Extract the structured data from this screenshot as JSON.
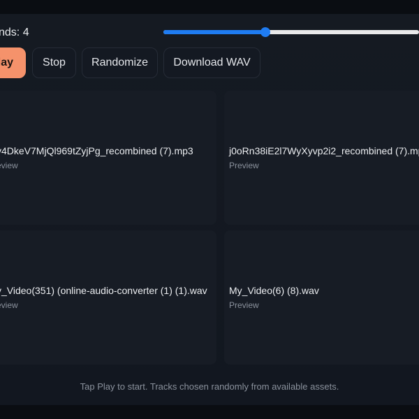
{
  "controls": {
    "rounds_label": "nds: 4",
    "rounds_value": 4,
    "slider_fill_fraction": 0.4
  },
  "toolbar": {
    "play_label": "lay",
    "stop_label": "Stop",
    "randomize_label": "Randomize",
    "download_label": "Download WAV"
  },
  "tracks": [
    {
      "name": "v4DkeV7MjQl969tZyjPg_recombined (7).mp3",
      "status": "eview"
    },
    {
      "name": "j0oRn38iE2l7WyXyvp2i2_recombined (7).mp",
      "status": "Preview"
    },
    {
      "name": "y_Video(351) (online-audio-converter (1) (1).wav",
      "status": "eview"
    },
    {
      "name": "My_Video(6) (8).wav",
      "status": "Preview"
    }
  ],
  "footer": {
    "note": "Tap Play to start. Tracks chosen randomly from available assets."
  },
  "colors": {
    "accent": "#f5926b",
    "slider": "#1f7cf2",
    "background": "#121720"
  }
}
